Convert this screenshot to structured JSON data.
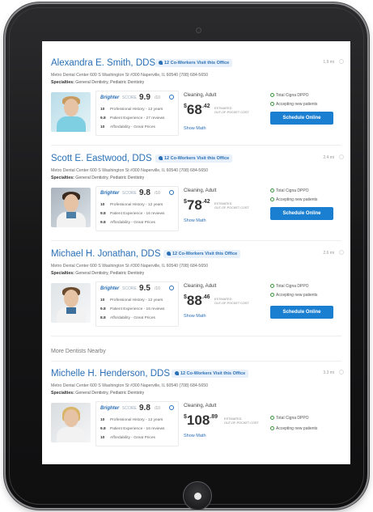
{
  "section_more": "More Dentists Nearby",
  "common": {
    "show_math": "Show Math",
    "estimated": "ESTIMATED",
    "out_of_pocket": "OUT-OF-POCKET COST",
    "brand": "Brighter",
    "brand_score": "SCORE",
    "score_max": "/10",
    "schedule_label": "Schedule Online"
  },
  "dentists": [
    {
      "name": "Alexandra E. Smith, DDS",
      "coworkers": "12 Co-Workers Visit this Office",
      "distance": "1.9 mi",
      "address": "Metro Dental Center     600 S Washington St #300 Naperville, IL 60540     (708) 684-5650",
      "specialties_label": "Specialties:",
      "specialties": "General Dentistry, Pediatric Dentistry",
      "score": "9.9",
      "metrics": [
        {
          "num": "10",
          "label": "Professional History - 12 years"
        },
        {
          "num": "9.8",
          "label": "Patient Experience - 27 reviews"
        },
        {
          "num": "10",
          "label": "Affordability - Great Prices"
        }
      ],
      "procedure": "Cleaning, Adult",
      "price_whole": "68",
      "price_cents": ".42",
      "features": [
        "Total Cigna DPPO",
        "Accepting new patients"
      ],
      "has_schedule": true
    },
    {
      "name": "Scott E. Eastwood, DDS",
      "coworkers": "12 Co-Workers Visit this Office",
      "distance": "2.4 mi",
      "address": "Metro Dental Center     600 S Washington St #300 Naperville, IL 60540     (708) 684-5650",
      "specialties_label": "Specialties:",
      "specialties": "General Dentistry, Pediatric Dentistry",
      "score": "9.8",
      "metrics": [
        {
          "num": "10",
          "label": "Professional History - 12 years"
        },
        {
          "num": "9.8",
          "label": "Patient Experience - 16 reviews"
        },
        {
          "num": "9.8",
          "label": "Affordability - Great Prices"
        }
      ],
      "procedure": "Cleaning, Adult",
      "price_whole": "78",
      "price_cents": ".42",
      "features": [
        "Total Cigna DPPO",
        "Accepting new patients"
      ],
      "has_schedule": true
    },
    {
      "name": "Michael H. Jonathan, DDS",
      "coworkers": "12 Co-Workers Visit this Office",
      "distance": "2.6 mi",
      "address": "Metro Dental Center     600 S Washington St #300 Naperville, IL 60540     (708) 684-5650",
      "specialties_label": "Specialties:",
      "specialties": "General Dentistry, Pediatric Dentistry",
      "score": "9.5",
      "metrics": [
        {
          "num": "10",
          "label": "Professional History - 12 years"
        },
        {
          "num": "9.8",
          "label": "Patient Experience - 16 reviews"
        },
        {
          "num": "8.8",
          "label": "Affordability - Great Prices"
        }
      ],
      "procedure": "Cleaning, Adult",
      "price_whole": "88",
      "price_cents": ".46",
      "features": [
        "Total Cigna DPPO",
        "Accepting new patients"
      ],
      "has_schedule": true
    },
    {
      "name": "Michelle H. Henderson, DDS",
      "coworkers": "12 Co-Workers Visit this Office",
      "distance": "3.3 mi",
      "address": "Metro Dental Center     600 S Washington St #300 Naperville, IL 60540     (708) 684-5650",
      "specialties_label": "Specialties:",
      "specialties": "General Dentistry, Pediatric Dentistry",
      "score": "9.8",
      "metrics": [
        {
          "num": "10",
          "label": "Professional History - 12 years"
        },
        {
          "num": "9.8",
          "label": "Patient Experience - 16 reviews"
        },
        {
          "num": "10",
          "label": "Affordability - Great Prices"
        }
      ],
      "procedure": "Cleaning, Adult",
      "price_whole": "108",
      "price_cents": ".89",
      "features": [
        "Total Cigna DPPO",
        "Accepting new patients"
      ],
      "has_schedule": false
    }
  ]
}
